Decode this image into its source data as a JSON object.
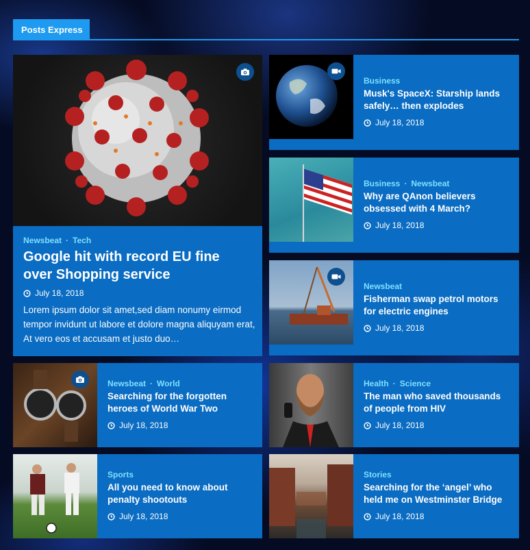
{
  "section": {
    "title": "Posts Express",
    "accent": "#1e9bf0",
    "card_bg": "#0a6cc2",
    "category_color": "#7fe0ff"
  },
  "featured": {
    "categories": [
      "Newsbeat",
      "Tech"
    ],
    "title": "Google hit with record EU fine over Shopping service",
    "date": "July 18, 2018",
    "excerpt": "Lorem ipsum dolor sit amet,sed diam nonumy eirmod tempor invidunt ut labore et dolore magna aliquyam erat, At vero eos et accusam et justo duo…",
    "media_icon": "camera-icon"
  },
  "posts": [
    {
      "categories": [
        "Business"
      ],
      "title": "Musk's SpaceX: Starship lands safely… then explodes",
      "date": "July 18, 2018",
      "media_icon": "video-icon"
    },
    {
      "categories": [
        "Business",
        "Newsbeat"
      ],
      "title": "Why are QAnon believers obsessed with 4 March?",
      "date": "July 18, 2018",
      "media_icon": ""
    },
    {
      "categories": [
        "Newsbeat"
      ],
      "title": "Fisherman swap petrol motors for electric engines",
      "date": "July 18, 2018",
      "media_icon": "video-icon"
    },
    {
      "categories": [
        "Newsbeat",
        "World"
      ],
      "title": "Searching for the forgotten heroes of World War Two",
      "date": "July 18, 2018",
      "media_icon": "camera-icon"
    },
    {
      "categories": [
        "Health",
        "Science"
      ],
      "title": "The man who saved thousands of people from HIV",
      "date": "July 18, 2018",
      "media_icon": ""
    },
    {
      "categories": [
        "Sports"
      ],
      "title": "All you need to know about penalty shootouts",
      "date": "July 18, 2018",
      "media_icon": ""
    },
    {
      "categories": [
        "Stories"
      ],
      "title": "Searching for the ‘angel’ who held me on Westminster Bridge",
      "date": "July 18, 2018",
      "media_icon": ""
    }
  ]
}
